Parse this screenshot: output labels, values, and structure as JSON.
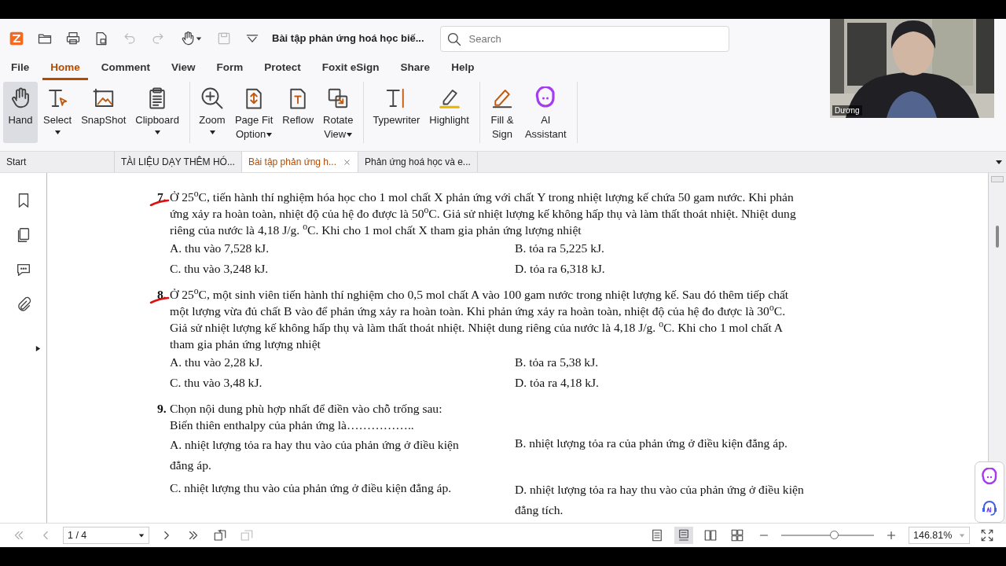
{
  "quick_toolbar": {
    "undo_disabled": true,
    "redo_disabled": true,
    "save_disabled": true,
    "document_title": "Bài tập phản ứng hoá học biế...",
    "search": {
      "placeholder": "Search"
    }
  },
  "menu_tabs": [
    {
      "label": "File",
      "selected": false
    },
    {
      "label": "Home",
      "selected": true
    },
    {
      "label": "Comment",
      "selected": false
    },
    {
      "label": "View",
      "selected": false
    },
    {
      "label": "Form",
      "selected": false
    },
    {
      "label": "Protect",
      "selected": false
    },
    {
      "label": "Foxit eSign",
      "selected": false
    },
    {
      "label": "Share",
      "selected": false
    },
    {
      "label": "Help",
      "selected": false
    }
  ],
  "ribbon_groups": [
    [
      {
        "lines": [
          "Hand"
        ],
        "selected": true,
        "dropdown": false
      },
      {
        "lines": [
          "Select"
        ],
        "selected": false,
        "dropdown": true
      },
      {
        "lines": [
          "SnapShot"
        ],
        "selected": false,
        "dropdown": false
      },
      {
        "lines": [
          "Clipboard"
        ],
        "selected": false,
        "dropdown": true
      }
    ],
    [
      {
        "lines": [
          "Zoom"
        ],
        "selected": false,
        "dropdown": true
      },
      {
        "lines": [
          "Page Fit",
          "Option"
        ],
        "selected": false,
        "dropdown": true
      },
      {
        "lines": [
          "Reflow"
        ],
        "selected": false,
        "dropdown": false
      },
      {
        "lines": [
          "Rotate",
          "View"
        ],
        "selected": false,
        "dropdown": true
      }
    ],
    [
      {
        "lines": [
          "Typewriter"
        ],
        "selected": false,
        "dropdown": false
      },
      {
        "lines": [
          "Highlight"
        ],
        "selected": false,
        "dropdown": false
      }
    ],
    [
      {
        "lines": [
          "Fill &",
          "Sign"
        ],
        "selected": false,
        "dropdown": false
      },
      {
        "lines": [
          "AI",
          "Assistant"
        ],
        "selected": false,
        "dropdown": false
      }
    ]
  ],
  "doc_tabs": [
    {
      "label": "Start",
      "selected": false,
      "closable": false
    },
    {
      "label": "TÀI LIỆU DẠY THÊM HÓ...",
      "selected": false,
      "closable": false
    },
    {
      "label": "Bài tập phản ứng h...",
      "selected": true,
      "closable": true
    },
    {
      "label": "Phản ứng hoá học và e...",
      "selected": false,
      "closable": false
    }
  ],
  "questions": [
    {
      "number": "7.",
      "annotated": true,
      "lines": [
        "Ở 25$^{o}$C, tiến hành thí nghiệm hóa học cho 1 mol chất X phản ứng với chất Y trong nhiệt lượng kế chứa 50 gam nước. Khi phản",
        "ứng xảy ra hoàn toàn, nhiệt độ của hệ đo được là 50$^{o}$C. Giả sử nhiệt lượng kế không hấp thụ và làm thất thoát nhiệt. Nhiệt dung",
        "riêng của nước là 4,18 J/g. $^{o}$C. Khi cho 1 mol chất X tham gia phản ứng lượng nhiệt"
      ],
      "options": [
        {
          "lines": [
            "A. thu vào 7,528 kJ."
          ]
        },
        {
          "lines": [
            "B. tỏa ra 5,225 kJ."
          ]
        },
        {
          "lines": [
            "C. thu vào 3,248 kJ."
          ]
        },
        {
          "lines": [
            "D. tỏa ra 6,318 kJ."
          ]
        }
      ]
    },
    {
      "number": "8.",
      "annotated": true,
      "lines": [
        "Ở 25$^{o}$C, một sinh viên tiến hành thí nghiệm cho 0,5 mol chất A vào 100 gam nước trong nhiệt lượng kế. Sau đó thêm tiếp chất",
        "một lượng vừa đủ chất B vào để phản ứng xảy ra hoàn toàn. Khi phản ứng xảy ra hoàn toàn, nhiệt độ của hệ đo được là 30$^{o}$C.",
        "Giả sử nhiệt lượng kế không hấp thụ và làm thất thoát nhiệt. Nhiệt dung riêng của nước là 4,18 J/g. $^{o}$C. Khi cho 1 mol chất A",
        "tham gia phản ứng lượng nhiệt"
      ],
      "options": [
        {
          "lines": [
            "A. thu vào 2,28 kJ."
          ]
        },
        {
          "lines": [
            "B. tỏa ra 5,38 kJ."
          ]
        },
        {
          "lines": [
            "C. thu vào 3,48 kJ."
          ]
        },
        {
          "lines": [
            "D. tỏa ra 4,18 kJ."
          ]
        }
      ]
    },
    {
      "number": "9.",
      "annotated": false,
      "lines": [
        "Chọn nội dung phù hợp nhất để điền vào chỗ trống sau:",
        "Biến thiên enthalpy của phản ứng là…………….."
      ],
      "options": [
        {
          "lines": [
            "A. nhiệt lượng tỏa ra hay thu vào của phản ứng ở điều kiện",
            "đẳng áp."
          ]
        },
        {
          "lines": [
            "B. nhiệt lượng tỏa ra của phản ứng ở điều kiện đẳng áp."
          ]
        },
        {
          "lines": [
            "C. nhiệt lượng thu vào của phản ứng ở điều kiện đẳng áp."
          ]
        },
        {
          "lines": [
            "D. nhiệt lượng tỏa ra hay thu vào của phản ứng ở điều kiện",
            "đẳng tích."
          ]
        }
      ]
    }
  ],
  "status_bar": {
    "page": "1 / 4",
    "view_modes": [
      {
        "selected": false
      },
      {
        "selected": true
      },
      {
        "selected": false
      },
      {
        "selected": false
      }
    ],
    "zoom_slider": {
      "level": 0.57
    },
    "zoom": "146.81%"
  },
  "video_overlay": {
    "participant_name": "Dương"
  }
}
